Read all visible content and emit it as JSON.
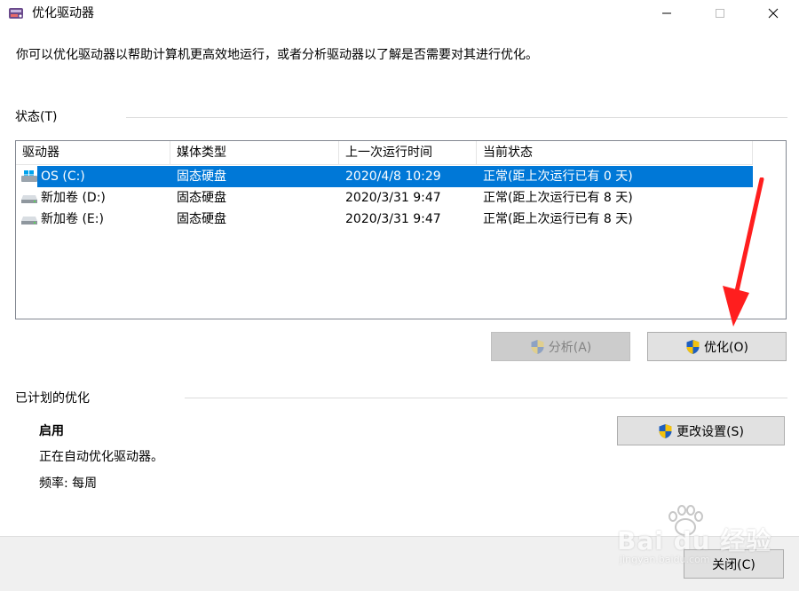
{
  "window": {
    "title": "优化驱动器",
    "controls": {
      "minimize_icon": "minimize-icon",
      "maximize_icon": "maximize-icon",
      "close_icon": "close-icon"
    }
  },
  "description": "你可以优化驱动器以帮助计算机更高效地运行，或者分析驱动器以了解是否需要对其进行优化。",
  "status": {
    "label": "状态(T)",
    "columns": [
      "驱动器",
      "媒体类型",
      "上一次运行时间",
      "当前状态"
    ],
    "rows": [
      {
        "drive": "OS (C:)",
        "media": "固态硬盘",
        "last_run": "2020/4/8 10:29",
        "state": "正常(距上次运行已有 0 天)",
        "selected": true,
        "icon": "windows-drive-icon"
      },
      {
        "drive": "新加卷 (D:)",
        "media": "固态硬盘",
        "last_run": "2020/3/31 9:47",
        "state": "正常(距上次运行已有 8 天)",
        "selected": false,
        "icon": "drive-icon"
      },
      {
        "drive": "新加卷 (E:)",
        "media": "固态硬盘",
        "last_run": "2020/3/31 9:47",
        "state": "正常(距上次运行已有 8 天)",
        "selected": false,
        "icon": "drive-icon"
      }
    ],
    "analyze_button": "分析(A)",
    "optimize_button": "优化(O)"
  },
  "scheduled": {
    "label": "已计划的优化",
    "enabled": "启用",
    "auto_text": "正在自动优化驱动器。",
    "frequency": "频率: 每周",
    "change_button": "更改设置(S)"
  },
  "footer": {
    "close_button": "关闭(C)"
  },
  "watermark": {
    "text": "Bai du 经验",
    "sub": "jingyan.baidu.com"
  },
  "colors": {
    "selection": "#0078d7",
    "arrow": "#ff1e1e",
    "shield_blue": "#1f5fbf",
    "shield_yellow": "#f4c20d"
  }
}
